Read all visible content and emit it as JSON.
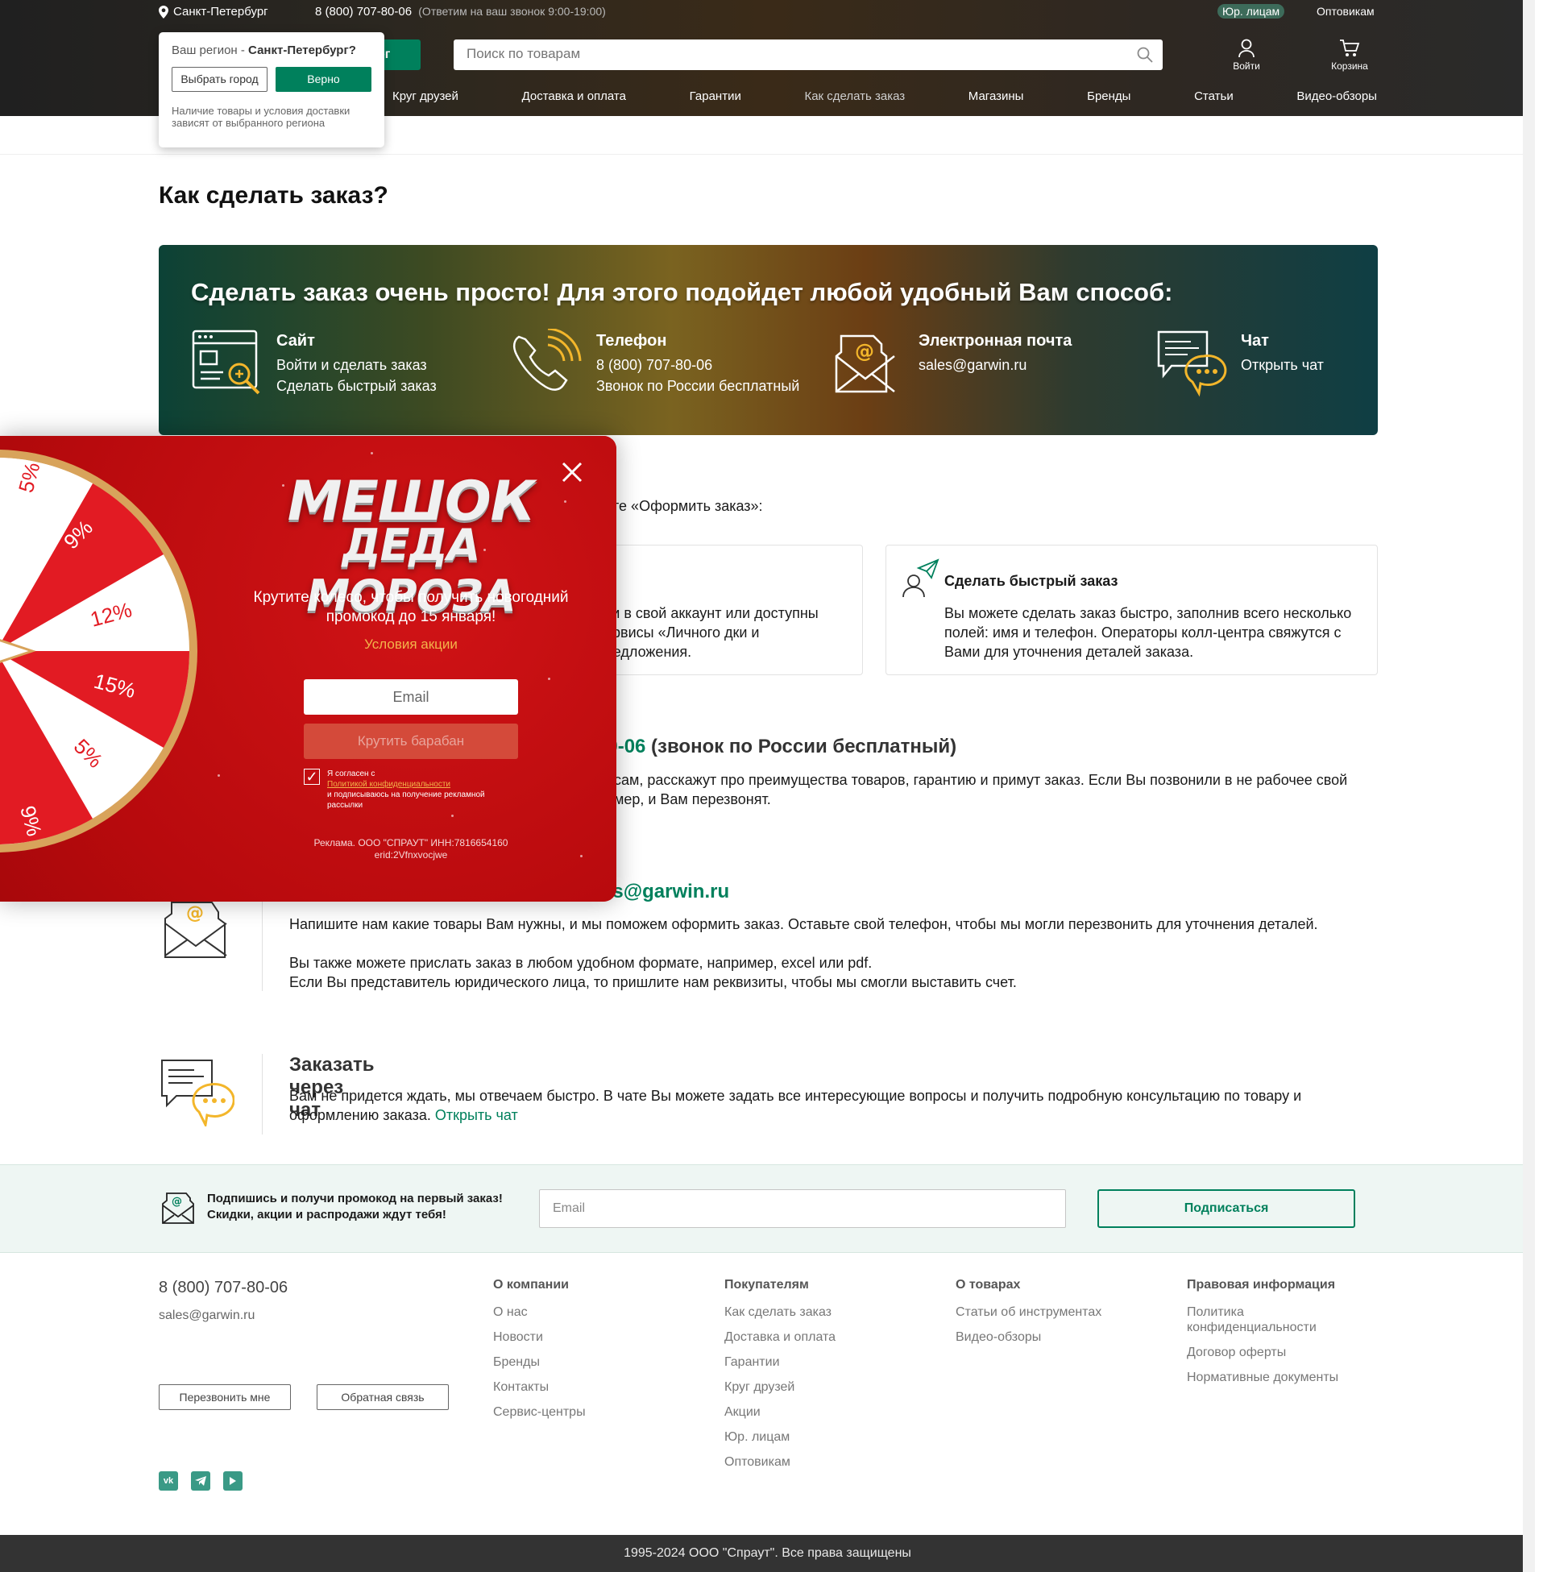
{
  "header": {
    "city": "Санкт-Петербург",
    "phone": "8 (800) 707-80-06",
    "phone_note": "(Ответим на ваш звонок 9:00-19:00)",
    "legal": "Юр. лицам",
    "wholesale": "Оптовикам",
    "catalog": "лог",
    "search_placeholder": "Поиск по товарам",
    "login": "Войти",
    "cart": "Корзина",
    "nav": [
      "Круг друзей",
      "Доставка и оплата",
      "Гарантии",
      "Как сделать заказ",
      "Магазины",
      "Бренды",
      "Статьи",
      "Видео-обзоры"
    ]
  },
  "region_popup": {
    "question_prefix": "Ваш регион - ",
    "question_city": "Санкт-Петербург?",
    "choose_city": "Выбрать город",
    "confirm": "Верно",
    "note": "Наличие товары и условия доставки зависят от выбранного региона"
  },
  "page": {
    "title": "Как сделать заказ?"
  },
  "banner": {
    "heading": "Сделать заказ очень просто! Для этого подойдет любой удобный Вам способ:",
    "methods": [
      {
        "title": "Сайт",
        "line1": "Войти и сделать заказ",
        "line2": "Сделать быстрый заказ"
      },
      {
        "title": "Телефон",
        "line1": "8 (800) 707-80-06",
        "line2": "Звонок по России бесплатный"
      },
      {
        "title": "Электронная почта",
        "line1": "sales@garwin.ru",
        "line2": ""
      },
      {
        "title": "Чат",
        "line1": "Открыть чат",
        "line2": ""
      }
    ]
  },
  "site_section": {
    "intro": "те «Оформить заказ»:",
    "login_card_text": "йти в свой аккаунт или доступны сервисы «Личного дки и предложения.",
    "quick_card_title": "Сделать быстрый заказ",
    "quick_card_text": "Вы можете сделать заказ быстро, заполнив всего несколько полей: имя и телефон. Операторы колл-центра свяжутся с Вами для уточнения деталей заказа."
  },
  "phone_section": {
    "head_green": "80-06",
    "head_rest": " (звонок по России бесплатный)",
    "text": "росам, расскажут про преимущества товаров, гарантию и примут заказ. Если Вы позвонили в не рабочее свой номер, и Вам перезвонят."
  },
  "email_section": {
    "head_green": "es@garwin.ru",
    "text1": "Напишите нам какие товары Вам нужны, и мы поможем оформить заказ. Оставьте свой телефон, чтобы мы могли перезвонить для уточнения деталей.",
    "text2": "Вы также можете прислать заказ в любом удобном формате, например, excel или pdf.",
    "text3": "Если Вы представитель юридического лица, то пришлите нам реквизиты, чтобы мы смогли выставить счет."
  },
  "chat_section": {
    "head": "Заказать через чат",
    "text": "Вам не придется ждать, мы отвечаем быстро. В чате Вы можете задать все интересующие вопросы и получить подробную консультацию по товару и оформлению заказа.",
    "link": "Открыть чат"
  },
  "subscribe": {
    "line1": "Подпишись и получи промокод на первый заказ!",
    "line2": "Скидки, акции и распродажи ждут тебя!",
    "placeholder": "Email",
    "button": "Подписаться"
  },
  "footer": {
    "phone": "8 (800) 707-80-06",
    "email": "sales@garwin.ru",
    "callback": "Перезвонить мне",
    "feedback": "Обратная связь",
    "social": [
      "vk-icon",
      "telegram-icon",
      "youtube-icon"
    ],
    "columns": [
      {
        "title": "О компании",
        "items": [
          "О нас",
          "Новости",
          "Бренды",
          "Контакты",
          "Сервис-центры"
        ]
      },
      {
        "title": "Покупателям",
        "items": [
          "Как сделать заказ",
          "Доставка и оплата",
          "Гарантии",
          "Круг друзей",
          "Акции",
          "Юр. лицам",
          "Оптовикам"
        ]
      },
      {
        "title": "О товарах",
        "items": [
          "Статьи об инструментах",
          "Видео-обзоры"
        ]
      },
      {
        "title": "Правовая информация",
        "items": [
          "Политика конфиденциальности",
          "Договор оферты",
          "Нормативные документы"
        ]
      }
    ],
    "copyright": "1995-2024 ООО \"Спраут\". Все права защищены"
  },
  "promo": {
    "logo_line1": "МЕШОК",
    "logo_line2": "ДЕДА МОРОЗА",
    "description": "Крутите колесо, чтобы получить новогодний промокод до 15 января!",
    "terms": "Условия акции",
    "email_placeholder": "Email",
    "spin_button": "Крутить барабан",
    "agree_prefix": "Я согласен с",
    "agree_link": "Политикой конфиденциальности",
    "agree_suffix": "и подписываюсь на получение рекламной рассылки",
    "ad_line1": "Реклама. ООО \"СПРАУТ\" ИНН:7816654160",
    "ad_line2": "erid:2Vfnxvocjwe",
    "wheel_segments": [
      "5%",
      "9%",
      "12%",
      "15%",
      "5%",
      "9%"
    ],
    "colors": {
      "red": "#c70f12",
      "gold": "#d8a35b",
      "segment_red": "#e21b23"
    }
  },
  "colors": {
    "accent": "#00805c",
    "gold_icon": "#f3b62b"
  }
}
